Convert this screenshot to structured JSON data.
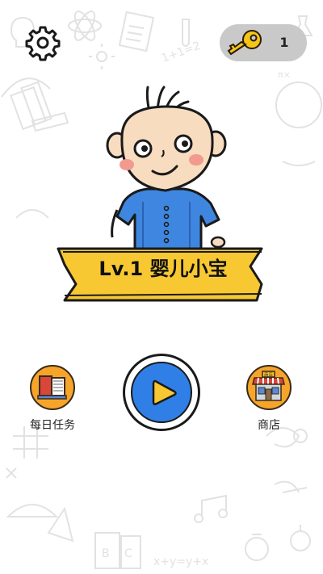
{
  "top_bar": {
    "settings_icon": "gear-icon",
    "keys": {
      "icon": "key-icon",
      "count": "1"
    }
  },
  "hero": {
    "character": "baby-character",
    "level_title": "Lv.1 婴儿小宝"
  },
  "actions": {
    "daily_tasks": {
      "label": "每日任务",
      "icon": "book-icon"
    },
    "play": {
      "icon": "play-icon"
    },
    "shop": {
      "label": "商店",
      "icon": "store-icon",
      "sign_text": "商店"
    }
  },
  "colors": {
    "accent_orange": "#f6a52a",
    "play_blue": "#2f7fe6",
    "banner_yellow": "#f7c832",
    "key_gold": "#f5c518",
    "shirt_blue": "#3e86e0"
  }
}
